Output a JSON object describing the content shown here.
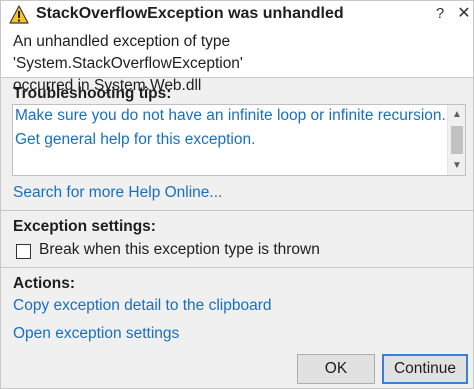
{
  "dialog": {
    "title": "StackOverflowException was unhandled",
    "help_glyph": "?",
    "close_glyph": "✕",
    "message_line1": "An unhandled exception of type 'System.StackOverflowException'",
    "message_line2": "occurred in System.Web.dll"
  },
  "troubleshooting": {
    "heading": "Troubleshooting tips:",
    "tips": [
      "Make sure you do not have an infinite loop or infinite recursion.",
      "Get general help for this exception."
    ],
    "search_link": "Search for more Help Online..."
  },
  "exception_settings": {
    "heading": "Exception settings:",
    "checkbox_label": "Break when this exception type is thrown",
    "checked": false
  },
  "actions": {
    "heading": "Actions:",
    "items": [
      "Copy exception detail to the clipboard",
      "Open exception settings"
    ]
  },
  "buttons": {
    "ok": "OK",
    "continue": "Continue"
  },
  "colors": {
    "link": "#1a6fbd",
    "warning_fill": "#f7c422",
    "focus_border": "#3c7fd8"
  },
  "icons": {
    "title_icon": "warning-icon",
    "scroll_up": "scroll-up-arrow-icon",
    "scroll_down": "scroll-down-arrow-icon"
  }
}
